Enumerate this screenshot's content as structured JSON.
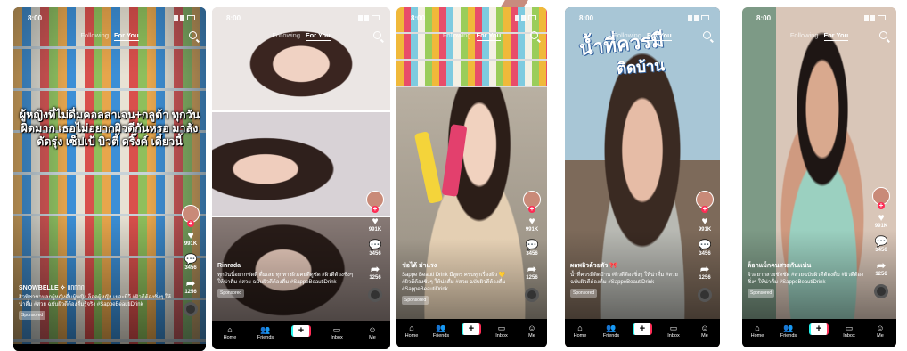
{
  "common": {
    "time": "8:00",
    "tab_following": "Following",
    "tab_for_you": "For You",
    "sponsored": "Sponsored",
    "nav": {
      "home": "Home",
      "friends": "Friends",
      "create": "+",
      "inbox": "Inbox",
      "me": "Me"
    }
  },
  "colors": {
    "accent_red": "#fe2c55",
    "accent_cyan": "#25f4ee",
    "nav_bg": "#000000"
  },
  "icons": [
    "heart-icon",
    "comment-icon",
    "share-icon",
    "music-disc-icon",
    "search-icon",
    "home-icon",
    "friends-icon",
    "inbox-icon",
    "profile-icon"
  ],
  "phones": [
    {
      "overlay": "ผู้หญิงที่ไม่ดื่มคอลลาเจน+กลูต้า ทุกวันผิดมาก เธอไม่อยากผิวดีกันหรอ มาลังดัดรุ่ง เซ็ปเป้ บิวตี้ ดริ๊งค์ เดี๋ยวนี้",
      "likes": "991K",
      "comments": "3456",
      "shares": "1256",
      "username": "SNOWBELLE ✧ ▯▯▯▯▯",
      "caption": "สิวพิชาชามลกผู้หญิงดื่มผู้หญิง ล็อคผู้หญิง เยอะมีวี #ผิวดีต้องชิ่งๆ ให้น่าดื่ม #สวย ฉบับผิวดีต้องดื่มรู้จริง #SappeBeautiDrink"
    },
    {
      "likes": "991K",
      "comments": "3456",
      "shares": "1256",
      "username": "Rinrada",
      "caption": "ทุกวันนี้อยากชัดดี ดื่มเลย ทุกทางผิวเคยดีดูชัด #ผิวดีต้องชิ่งๆ ให้น่าดื่ม #สวย ฉบับผิวดีต้องดื่ม #SappeBeautiDrink"
    },
    {
      "likes": "991K",
      "comments": "3456",
      "shares": "1256",
      "username": "ช่อได้ ม่าแรง",
      "caption": "Sappe Beauti Drink มีสูตร ครบทุกเรื่องผิว 💛 #ผิวดีต้องชิ่งๆ ให้น่าดื่ม #สวย ฉบับผิวดีต้องดื่ม #SappeBeautiDrink"
    },
    {
      "headline1": "น้ำที่ควรมี",
      "headline2": "ติดบ้าน",
      "likes": "991K",
      "comments": "3456",
      "shares": "1256",
      "username": "ผลพลิวด้วยตัว 🎀",
      "caption": "น้ำที่ควรมีติดบ้าน #ผิวดีต้องชิ่งๆ ให้น่าดื่ม #สวยฉบับผิวดีต้องดื่ม #SappeBeautiDrink"
    },
    {
      "likes": "991K",
      "comments": "3456",
      "shares": "1256",
      "username": "ล็อกแม็กคนสวยกันเเน่น",
      "caption": "ผิวอยากสวยชัดชัด #สวยฉบับผิวดีต้องดื่ม #ผิวดีต้องชิ่งๆ ให้น่าดื่ม #SappeBeautiDrink"
    }
  ]
}
